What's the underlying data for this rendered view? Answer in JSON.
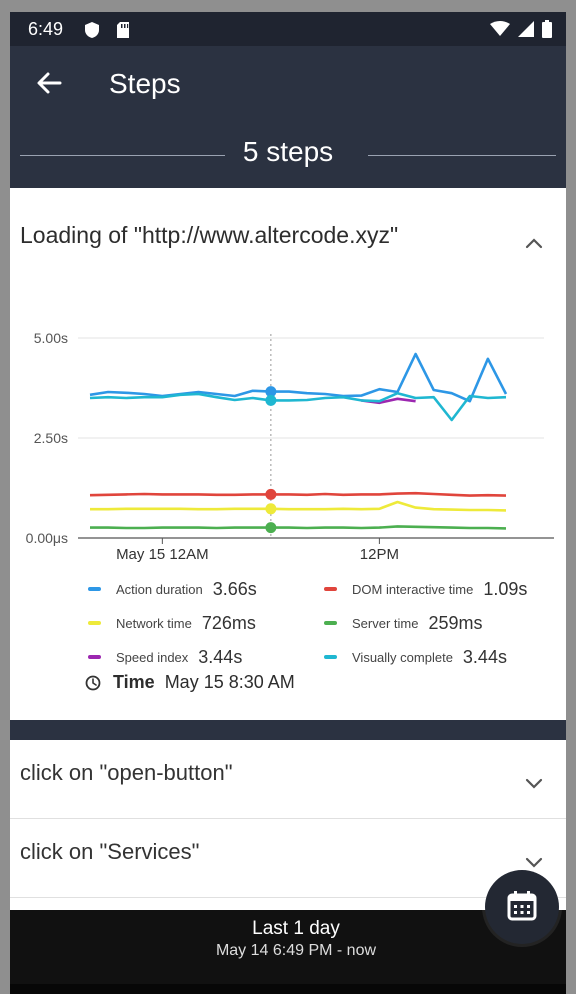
{
  "status_bar": {
    "time": "6:49"
  },
  "appbar": {
    "title": "Steps"
  },
  "steps_header": {
    "text": "5 steps"
  },
  "step1": {
    "title": "Loading of \"http://www.altercode.xyz\"",
    "expanded": true
  },
  "chart_data": {
    "type": "line",
    "yticks": [
      "5.00s",
      "2.50s",
      "0.00μs"
    ],
    "xticks": [
      "May 15 12AM",
      "12PM"
    ],
    "ylim": [
      0,
      5.0
    ],
    "series": [
      {
        "name": "Action duration",
        "color": "#2d97e6",
        "values": [
          3.58,
          3.65,
          3.63,
          3.6,
          3.55,
          3.6,
          3.65,
          3.6,
          3.55,
          3.68,
          3.66,
          3.66,
          3.62,
          3.6,
          3.55,
          3.56,
          3.72,
          3.65,
          4.6,
          3.7,
          3.62,
          3.42,
          4.48,
          3.6
        ],
        "highlight_index": 10
      },
      {
        "name": "DOM interactive time",
        "color": "#e0453c",
        "values": [
          1.07,
          1.08,
          1.09,
          1.1,
          1.09,
          1.09,
          1.09,
          1.08,
          1.08,
          1.09,
          1.09,
          1.09,
          1.08,
          1.1,
          1.08,
          1.09,
          1.09,
          1.11,
          1.12,
          1.1,
          1.08,
          1.06,
          1.07,
          1.06
        ],
        "highlight_index": 10
      },
      {
        "name": "Network time",
        "color": "#eeea3a",
        "values": [
          0.72,
          0.72,
          0.73,
          0.73,
          0.73,
          0.73,
          0.72,
          0.72,
          0.73,
          0.73,
          0.73,
          0.72,
          0.72,
          0.72,
          0.73,
          0.72,
          0.73,
          0.9,
          0.76,
          0.72,
          0.71,
          0.7,
          0.7,
          0.69
        ],
        "highlight_index": 10
      },
      {
        "name": "Server time",
        "color": "#4caf50",
        "values": [
          0.26,
          0.26,
          0.25,
          0.25,
          0.26,
          0.26,
          0.26,
          0.25,
          0.26,
          0.26,
          0.26,
          0.26,
          0.25,
          0.26,
          0.26,
          0.25,
          0.26,
          0.29,
          0.28,
          0.27,
          0.26,
          0.25,
          0.25,
          0.24
        ],
        "highlight_index": 10
      },
      {
        "name": "Speed index",
        "color": "#9c27b0",
        "values": [
          null,
          null,
          null,
          null,
          null,
          null,
          null,
          null,
          null,
          null,
          null,
          null,
          null,
          null,
          null,
          3.44,
          3.38,
          3.48,
          3.42,
          null,
          null,
          null,
          null,
          null
        ],
        "highlight_index": 10
      },
      {
        "name": "Visually complete",
        "color": "#1fb7d1",
        "values": [
          3.5,
          3.52,
          3.5,
          3.52,
          3.52,
          3.58,
          3.6,
          3.52,
          3.45,
          3.5,
          3.44,
          3.44,
          3.45,
          3.5,
          3.52,
          3.44,
          3.42,
          3.62,
          3.5,
          3.52,
          2.95,
          3.55,
          3.5,
          3.52
        ],
        "highlight_index": 10
      }
    ]
  },
  "legend": [
    {
      "label": "Action duration",
      "value": "3.66s",
      "color": "#2d97e6"
    },
    {
      "label": "DOM interactive time",
      "value": "1.09s",
      "color": "#e0453c"
    },
    {
      "label": "Network time",
      "value": "726ms",
      "color": "#eeea3a"
    },
    {
      "label": "Server time",
      "value": "259ms",
      "color": "#4caf50"
    },
    {
      "label": "Speed index",
      "value": "3.44s",
      "color": "#9c27b0"
    },
    {
      "label": "Visually complete",
      "value": "3.44s",
      "color": "#1fb7d1"
    }
  ],
  "time_row": {
    "label": "Time",
    "value": "May 15 8:30 AM"
  },
  "step2": {
    "title": "click on \"open-button\""
  },
  "step3": {
    "title": "click on \"Services\""
  },
  "bottom_bar": {
    "title": "Last 1 day",
    "subtitle": "May 14 6:49 PM - now"
  }
}
